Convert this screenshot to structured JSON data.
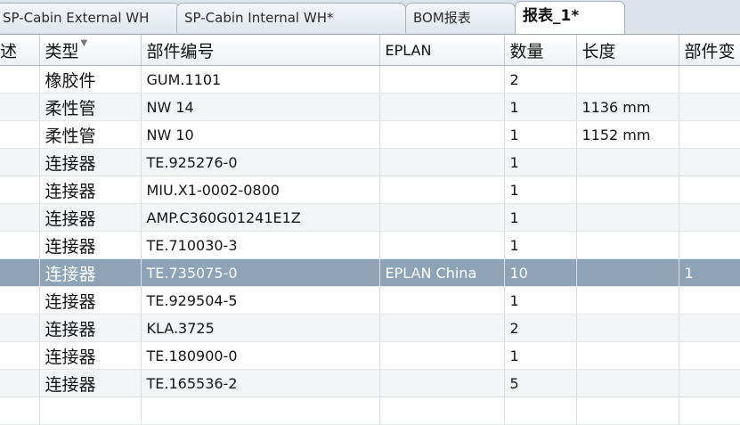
{
  "tabs": [
    {
      "label": "SP-Cabin External WH"
    },
    {
      "label": "SP-Cabin Internal WH*"
    },
    {
      "label": "BOM报表"
    },
    {
      "label": "报表_1*"
    }
  ],
  "columns": [
    "述",
    "类型",
    "部件编号",
    "EPLAN",
    "数量",
    "长度",
    "部件变"
  ],
  "rows": [
    {
      "type": "橡胶件",
      "part": "GUM.1101",
      "eplan": "",
      "qty": "2",
      "length": "",
      "var": ""
    },
    {
      "type": "柔性管",
      "part": "NW 14",
      "eplan": "",
      "qty": "1",
      "length": "1136 mm",
      "var": ""
    },
    {
      "type": "柔性管",
      "part": "NW 10",
      "eplan": "",
      "qty": "1",
      "length": "1152 mm",
      "var": ""
    },
    {
      "type": "连接器",
      "part": "TE.925276-0",
      "eplan": "",
      "qty": "1",
      "length": "",
      "var": ""
    },
    {
      "type": "连接器",
      "part": "MIU.X1-0002-0800",
      "eplan": "",
      "qty": "1",
      "length": "",
      "var": ""
    },
    {
      "type": "连接器",
      "part": "AMP.C360G01241E1Z",
      "eplan": "",
      "qty": "1",
      "length": "",
      "var": ""
    },
    {
      "type": "连接器",
      "part": "TE.710030-3",
      "eplan": "",
      "qty": "1",
      "length": "",
      "var": ""
    },
    {
      "type": "连接器",
      "part": "TE.735075-0",
      "eplan": "EPLAN China",
      "qty": "10",
      "length": "",
      "var": "1"
    },
    {
      "type": "连接器",
      "part": "TE.929504-5",
      "eplan": "",
      "qty": "1",
      "length": "",
      "var": ""
    },
    {
      "type": "连接器",
      "part": "KLA.3725",
      "eplan": "",
      "qty": "2",
      "length": "",
      "var": ""
    },
    {
      "type": "连接器",
      "part": "TE.180900-0",
      "eplan": "",
      "qty": "1",
      "length": "",
      "var": ""
    },
    {
      "type": "连接器",
      "part": "TE.165536-2",
      "eplan": "",
      "qty": "5",
      "length": "",
      "var": ""
    },
    {
      "type": "",
      "part": "",
      "eplan": "",
      "qty": "",
      "length": "",
      "var": ""
    }
  ],
  "selected_row": 7
}
